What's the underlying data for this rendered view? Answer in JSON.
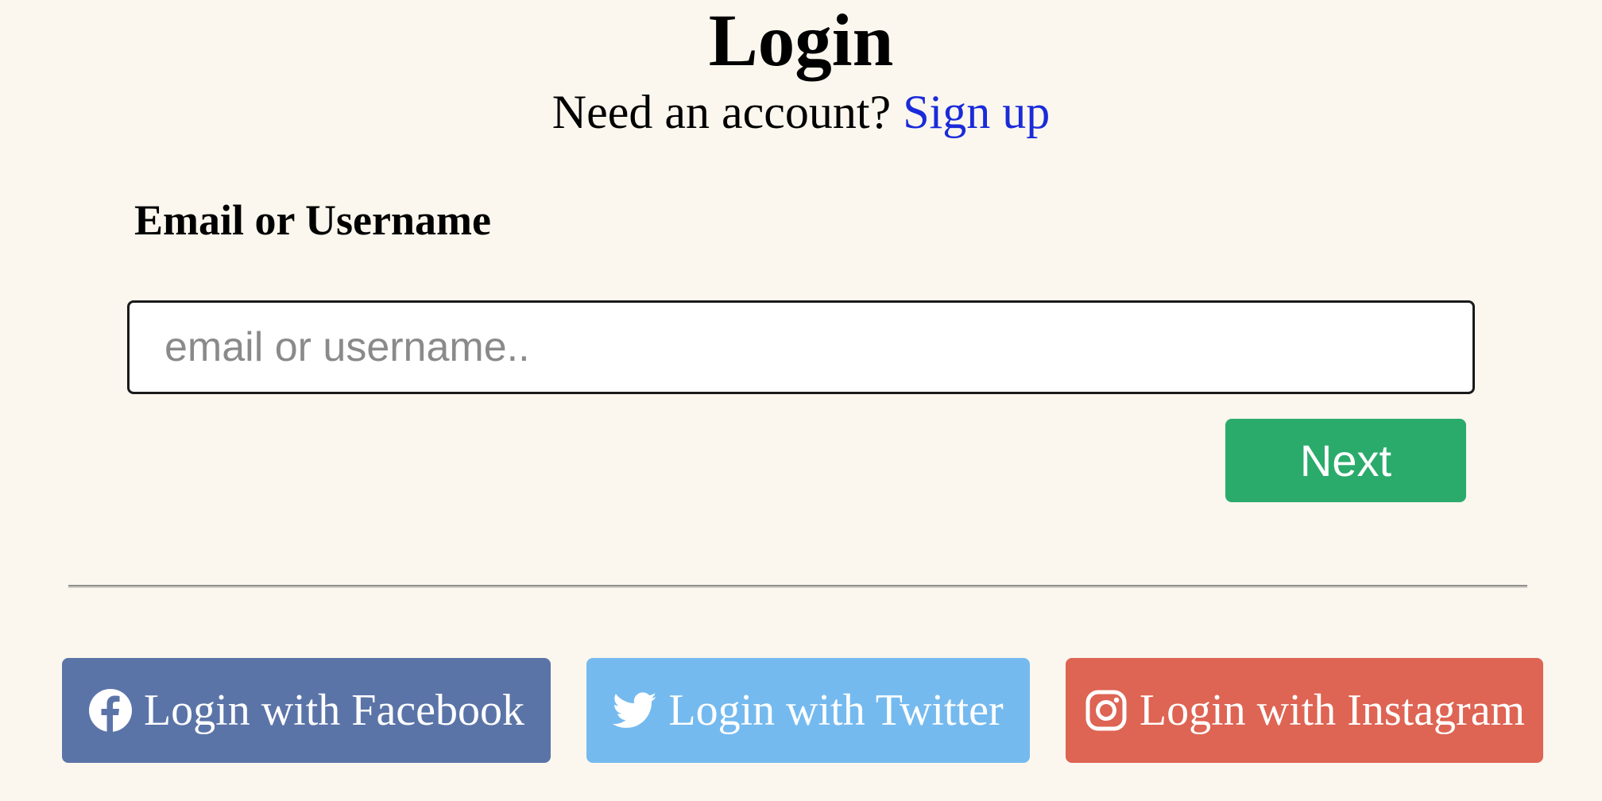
{
  "header": {
    "title": "Login",
    "prompt": "Need an account?",
    "signup_link": "Sign up"
  },
  "form": {
    "label": "Email or Username",
    "input_value": "",
    "input_placeholder": "email or username..",
    "next_label": "Next"
  },
  "social": [
    {
      "label": "Login with Facebook",
      "icon": "facebook-icon",
      "color": "#5b74a8"
    },
    {
      "label": "Login with Twitter",
      "icon": "twitter-icon",
      "color": "#75baef"
    },
    {
      "label": "Login with Instagram",
      "icon": "instagram-icon",
      "color": "#de6453"
    }
  ],
  "colors": {
    "background": "#fbf7ee",
    "link": "#1a2bd9",
    "next_button": "#2bab6b"
  }
}
